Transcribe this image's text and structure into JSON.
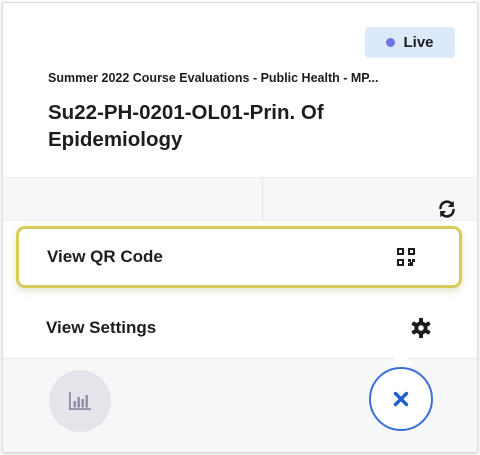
{
  "badge": {
    "label": "Live",
    "dot_color": "#6b74e0"
  },
  "header": {
    "subtitle": "Summer 2022 Course Evaluations - Public Health - MP...",
    "title": "Su22-PH-0201-OL01-Prin. Of Epidemiology"
  },
  "toolbar": {
    "refresh_icon": "refresh-icon"
  },
  "menu": {
    "items": [
      {
        "label": "View QR Code",
        "icon": "qr-code-icon"
      },
      {
        "label": "View Settings",
        "icon": "gear-icon"
      }
    ]
  },
  "footer": {
    "stats_icon": "bar-chart-icon",
    "close_icon": "close-icon"
  },
  "colors": {
    "badge_bg": "#dbe9fb",
    "highlight_border": "#d7cc5a",
    "close_accent": "#3a6fd8",
    "close_icon": "#1f5fd0"
  }
}
